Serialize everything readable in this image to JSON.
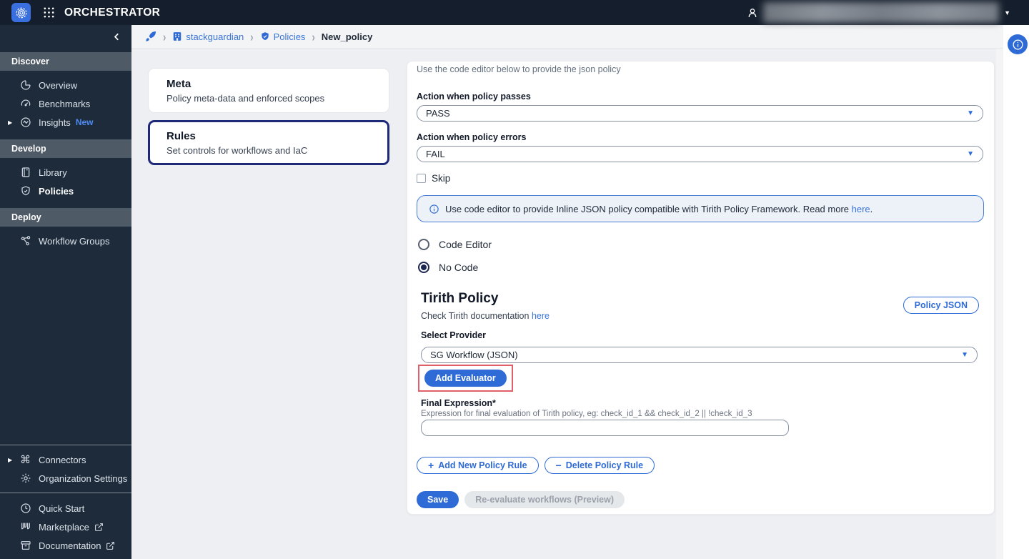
{
  "topbar": {
    "title": "ORCHESTRATOR",
    "caret": "▼"
  },
  "breadcrumb": {
    "org": "stackguardian",
    "section": "Policies",
    "current": "New_policy",
    "separator": "›"
  },
  "sidebar": {
    "sections": [
      {
        "header": "Discover",
        "items": [
          {
            "label": "Overview"
          },
          {
            "label": "Benchmarks"
          },
          {
            "label": "Insights",
            "badge": "New"
          }
        ]
      },
      {
        "header": "Develop",
        "items": [
          {
            "label": "Library"
          },
          {
            "label": "Policies"
          }
        ]
      },
      {
        "header": "Deploy",
        "items": [
          {
            "label": "Workflow Groups"
          }
        ]
      }
    ],
    "secondary": [
      {
        "label": "Connectors",
        "glyph": "⌘"
      },
      {
        "label": "Organization Settings"
      }
    ],
    "footer": [
      {
        "label": "Quick Start"
      },
      {
        "label": "Marketplace"
      },
      {
        "label": "Documentation"
      }
    ],
    "expand_caret": "▶"
  },
  "nav_cards": [
    {
      "title": "Meta",
      "subtitle": "Policy meta-data and enforced scopes"
    },
    {
      "title": "Rules",
      "subtitle": "Set controls for workflows and IaC"
    }
  ],
  "form": {
    "top_note": "Use the code editor below to provide the json policy",
    "pass_label": "Action when policy passes",
    "pass_value": "PASS",
    "errors_label": "Action when policy errors",
    "errors_value": "FAIL",
    "select_caret": "▼",
    "skip_label": "Skip",
    "banner_text": "Use code editor to provide Inline JSON policy compatible with Tirith Policy Framework. Read more ",
    "banner_link": "here",
    "banner_period": ".",
    "radio_code_editor": "Code Editor",
    "radio_no_code": "No Code",
    "tirith_title": "Tirith Policy",
    "policy_json_button": "Policy JSON",
    "doc_text": "Check Tirith documentation ",
    "doc_link": "here",
    "provider_label": "Select Provider",
    "provider_value": "SG Workflow (JSON)",
    "add_evaluator_button": "Add Evaluator",
    "final_expression_label": "Final Expression*",
    "final_expression_hint": "Expression for final evaluation of Tirith policy, eg: check_id_1 && check_id_2 || !check_id_3",
    "add_rule_button": "Add New Policy Rule",
    "add_rule_sign": "+",
    "delete_rule_button": "Delete Policy Rule",
    "delete_rule_sign": "−",
    "save_button": "Save",
    "reevaluate_button": "Re-evaluate workflows (Preview)"
  },
  "colors": {
    "accent_blue": "#2e6bd6",
    "link_blue": "#3b74d8",
    "topbar_bg": "#141e2c",
    "sidebar_bg": "#1d2b3b",
    "section_header_bg": "#4f5a67",
    "rules_border": "#1e2a78",
    "annotation_red": "#e0606a",
    "banner_bg": "#edf1f8",
    "new_badge": "#4d8cf5"
  }
}
